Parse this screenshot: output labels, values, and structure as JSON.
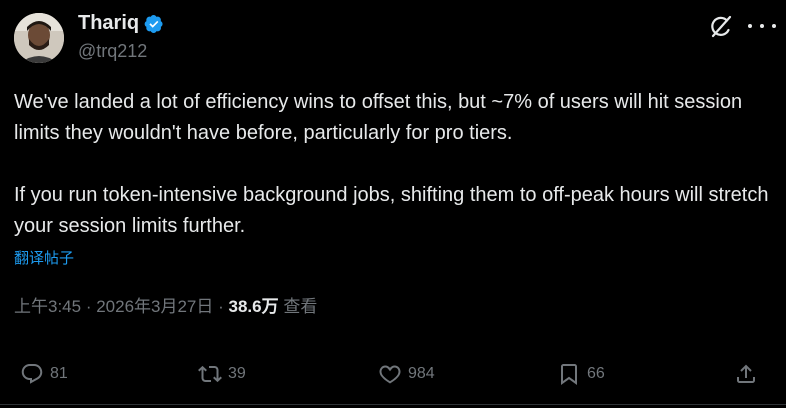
{
  "author": {
    "name": "Thariq",
    "handle": "@trq212",
    "verified": true,
    "accent": "#1d9bf0"
  },
  "post": {
    "paragraphs": [
      "We've landed a lot of efficiency wins to offset this, but ~7% of users will hit session limits they wouldn't have before, particularly for pro tiers.",
      "If you run token-intensive background jobs, shifting them to off-peak hours will stretch your session limits further."
    ],
    "translate_label": "翻译帖子"
  },
  "meta": {
    "time": "上午3:45",
    "separator1": " · ",
    "date": "2026年3月27日",
    "separator2": " · ",
    "views_count": "38.6万",
    "views_label": " 查看"
  },
  "actions": {
    "replies": "81",
    "reposts": "39",
    "likes": "984",
    "bookmarks": "66"
  },
  "icons": [
    "avatar",
    "verified-badge-icon",
    "grok-icon",
    "more-options-icon",
    "reply-icon",
    "repost-icon",
    "like-icon",
    "bookmark-icon",
    "share-icon"
  ]
}
